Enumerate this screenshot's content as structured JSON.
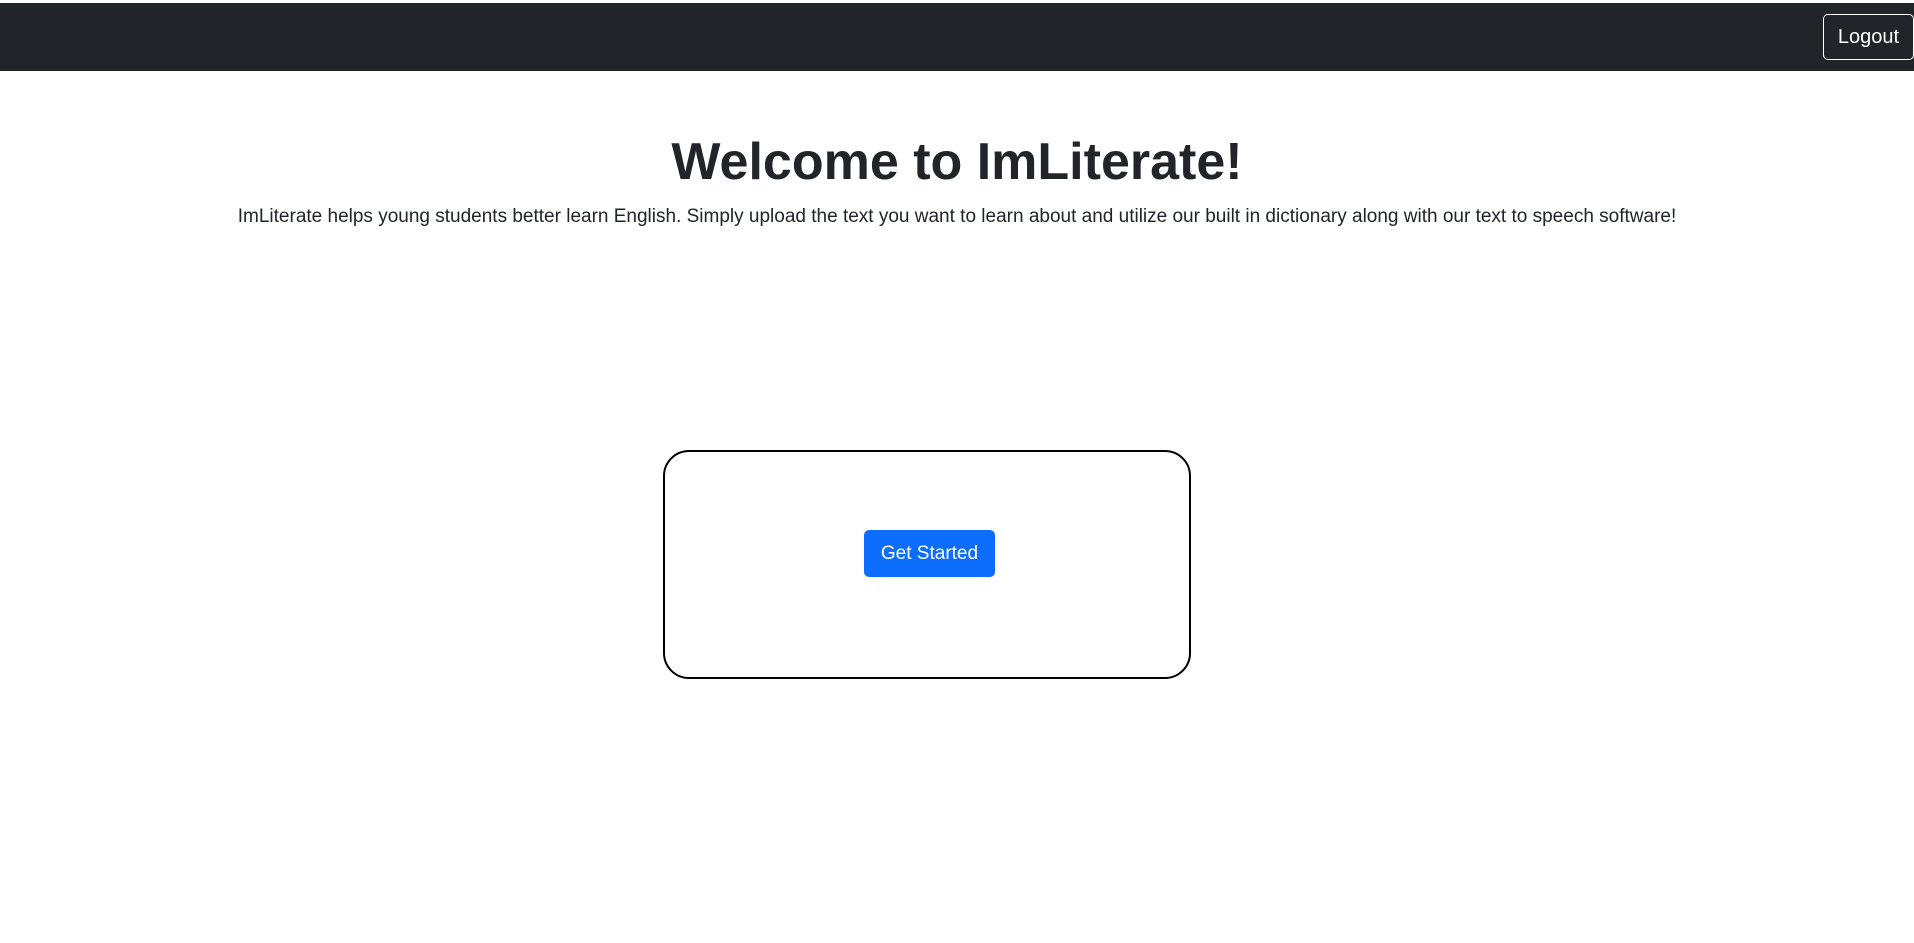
{
  "header": {
    "logout_label": "Logout",
    "background_color": "#212529"
  },
  "main": {
    "title": "Welcome to ImLiterate!",
    "subtitle": "ImLiterate helps young students better learn English. Simply upload the text you want to learn about and utilize our built in dictionary along with our text to speech software!",
    "cta_label": "Get Started",
    "accent_color": "#0d6efd"
  }
}
